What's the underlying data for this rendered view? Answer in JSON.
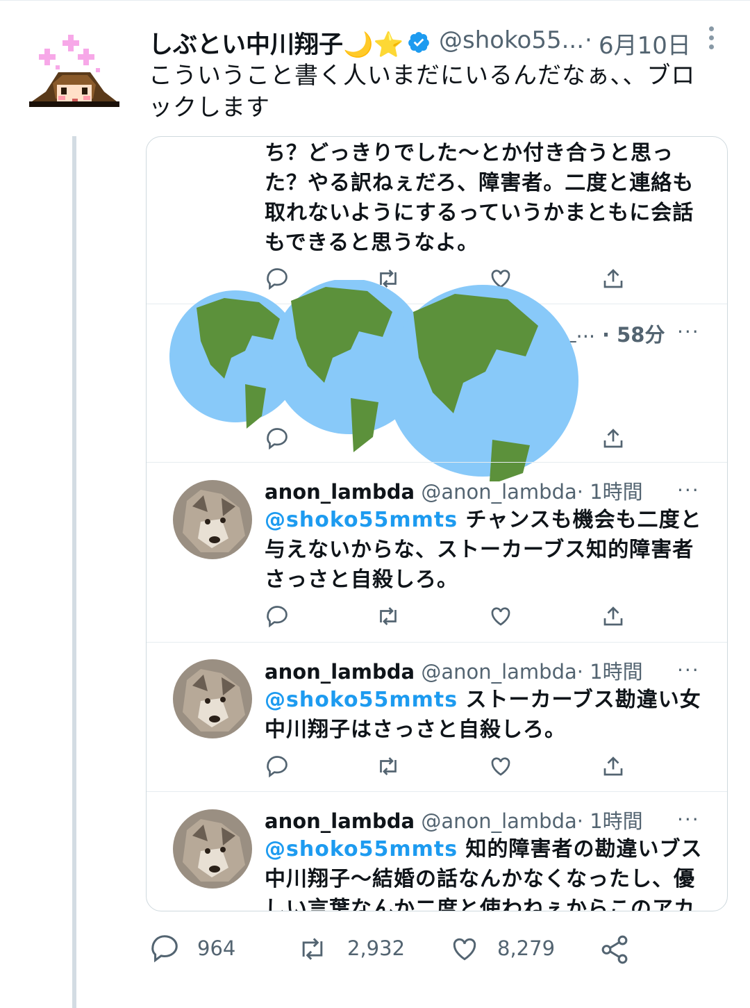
{
  "tweet": {
    "display_name": "しぶとい中川翔子",
    "name_emoji": "🌙⭐",
    "handle": "@shoko55...",
    "dot": "·",
    "date": "6月10日",
    "text": "こういうこと書く人いまだにいるんだなぁ、、ブロックします"
  },
  "quote": {
    "top_text": "ち？どっきりでした〜とか付き合うと思った？やる訳ねぇだろ、障害者。二度と連絡も取れないようにするっていうかまともに会話もできると思うなよ。",
    "hidden_row_time": "· 58分",
    "hidden_row_handle_tail": "_...",
    "more": "···",
    "replies": [
      {
        "name": "anon_lambda",
        "handle": "@anon_lambda",
        "time": "· 1時間",
        "mention": "@shoko55mmts",
        "text": " チャンスも機会も二度と与えないからな、ストーカーブス知的障害者さっさと自殺しろ。"
      },
      {
        "name": "anon_lambda",
        "handle": "@anon_lambda",
        "time": "· 1時間",
        "mention": "@shoko55mmts",
        "text": " ストーカーブス勘違い女中川翔子はさっさと自殺しろ。"
      },
      {
        "name": "anon_lambda",
        "handle": "@anon_lambda",
        "time": "· 1時間",
        "mention": "@shoko55mmts",
        "text": " 知的障害者の勘違いブス中川翔子〜結婚の話なんかなくなったし、優しい言葉なんか二度と使わねぇからこのアカ"
      }
    ]
  },
  "stats": {
    "replies": "964",
    "retweets": "2,932",
    "likes": "8,279"
  },
  "icons": [
    "verified-badge-icon",
    "reply-icon",
    "retweet-icon",
    "like-icon",
    "share-icon",
    "more-icon",
    "globe-emoji"
  ],
  "colors": {
    "link": "#1d9bf0",
    "muted": "#536471",
    "globe_ocean": "#88c9f9",
    "globe_land": "#5c913b"
  }
}
